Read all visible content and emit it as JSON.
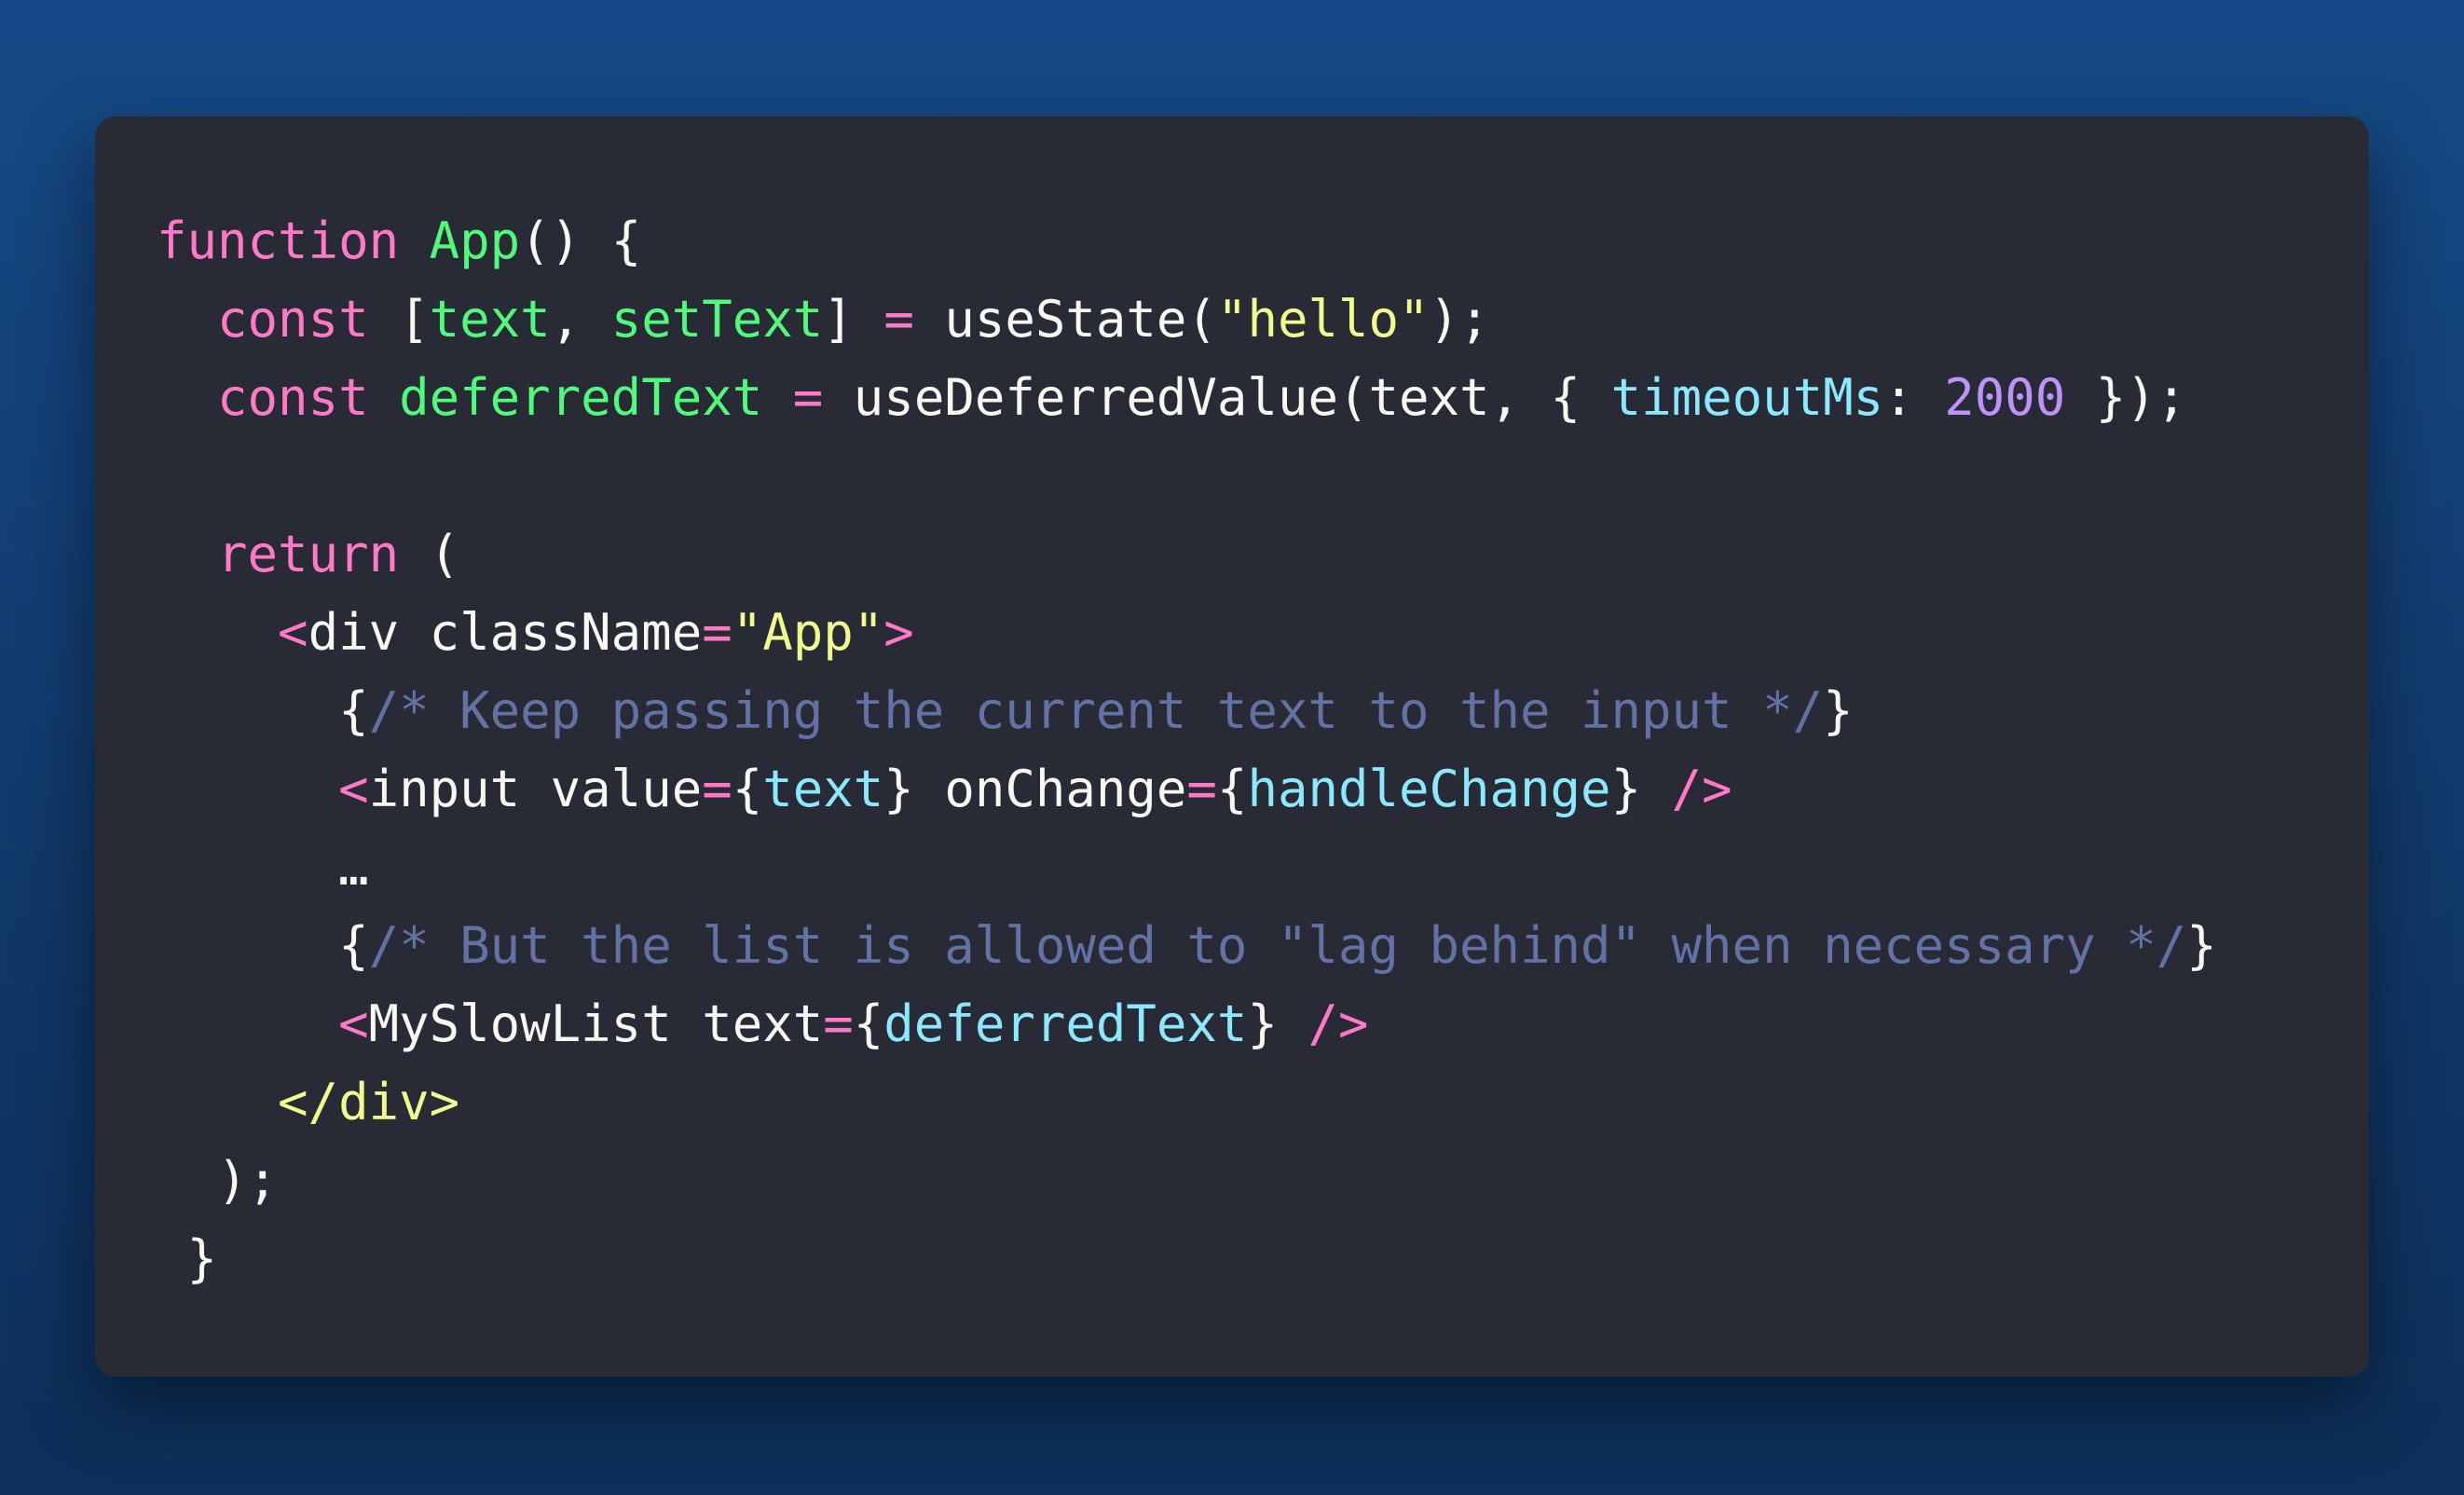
{
  "colors": {
    "background": "#144274",
    "editor_background": "#282a36",
    "keyword": "#ff79c6",
    "function_name": "#50fa7b",
    "string": "#f1fa8c",
    "property": "#8be9fd",
    "number": "#bd93f9",
    "comment": "#6272a4",
    "plain": "#f8f8f2"
  },
  "code": {
    "lines": [
      [
        {
          "t": "function",
          "c": "keyword"
        },
        {
          "t": " ",
          "c": "plain"
        },
        {
          "t": "App",
          "c": "function_name"
        },
        {
          "t": "() {",
          "c": "plain"
        }
      ],
      [
        {
          "t": "  ",
          "c": "plain"
        },
        {
          "t": "const",
          "c": "keyword"
        },
        {
          "t": " [",
          "c": "plain"
        },
        {
          "t": "text",
          "c": "function_name"
        },
        {
          "t": ", ",
          "c": "plain"
        },
        {
          "t": "setText",
          "c": "function_name"
        },
        {
          "t": "] ",
          "c": "plain"
        },
        {
          "t": "=",
          "c": "keyword"
        },
        {
          "t": " useState(",
          "c": "plain"
        },
        {
          "t": "\"hello\"",
          "c": "string"
        },
        {
          "t": ");",
          "c": "plain"
        }
      ],
      [
        {
          "t": "  ",
          "c": "plain"
        },
        {
          "t": "const",
          "c": "keyword"
        },
        {
          "t": " ",
          "c": "plain"
        },
        {
          "t": "deferredText",
          "c": "function_name"
        },
        {
          "t": " ",
          "c": "plain"
        },
        {
          "t": "=",
          "c": "keyword"
        },
        {
          "t": " useDeferredValue(text, { ",
          "c": "plain"
        },
        {
          "t": "timeoutMs",
          "c": "property"
        },
        {
          "t": ": ",
          "c": "plain"
        },
        {
          "t": "2000",
          "c": "number"
        },
        {
          "t": " });",
          "c": "plain"
        }
      ],
      [],
      [
        {
          "t": "  ",
          "c": "plain"
        },
        {
          "t": "return",
          "c": "keyword"
        },
        {
          "t": " (",
          "c": "plain"
        }
      ],
      [
        {
          "t": "    ",
          "c": "plain"
        },
        {
          "t": "<",
          "c": "keyword"
        },
        {
          "t": "div className",
          "c": "plain"
        },
        {
          "t": "=",
          "c": "keyword"
        },
        {
          "t": "\"App\"",
          "c": "string"
        },
        {
          "t": ">",
          "c": "keyword"
        }
      ],
      [
        {
          "t": "      {",
          "c": "plain"
        },
        {
          "t": "/* Keep passing the current text to the input */",
          "c": "comment"
        },
        {
          "t": "}",
          "c": "plain"
        }
      ],
      [
        {
          "t": "      ",
          "c": "plain"
        },
        {
          "t": "<",
          "c": "keyword"
        },
        {
          "t": "input value",
          "c": "plain"
        },
        {
          "t": "=",
          "c": "keyword"
        },
        {
          "t": "{",
          "c": "plain"
        },
        {
          "t": "text",
          "c": "property"
        },
        {
          "t": "} onChange",
          "c": "plain"
        },
        {
          "t": "=",
          "c": "keyword"
        },
        {
          "t": "{",
          "c": "plain"
        },
        {
          "t": "handleChange",
          "c": "property"
        },
        {
          "t": "} ",
          "c": "plain"
        },
        {
          "t": "/>",
          "c": "keyword"
        }
      ],
      [
        {
          "t": "      …",
          "c": "plain"
        }
      ],
      [
        {
          "t": "      {",
          "c": "plain"
        },
        {
          "t": "/* But the list is allowed to \"lag behind\" when necessary */",
          "c": "comment"
        },
        {
          "t": "}",
          "c": "plain"
        }
      ],
      [
        {
          "t": "      ",
          "c": "plain"
        },
        {
          "t": "<",
          "c": "keyword"
        },
        {
          "t": "MySlowList text",
          "c": "plain"
        },
        {
          "t": "=",
          "c": "keyword"
        },
        {
          "t": "{",
          "c": "plain"
        },
        {
          "t": "deferredText",
          "c": "property"
        },
        {
          "t": "} ",
          "c": "plain"
        },
        {
          "t": "/>",
          "c": "keyword"
        }
      ],
      [
        {
          "t": "    ",
          "c": "plain"
        },
        {
          "t": "</div>",
          "c": "string"
        }
      ],
      [
        {
          "t": "  );",
          "c": "plain"
        }
      ],
      [
        {
          "t": " }",
          "c": "plain"
        }
      ]
    ]
  }
}
